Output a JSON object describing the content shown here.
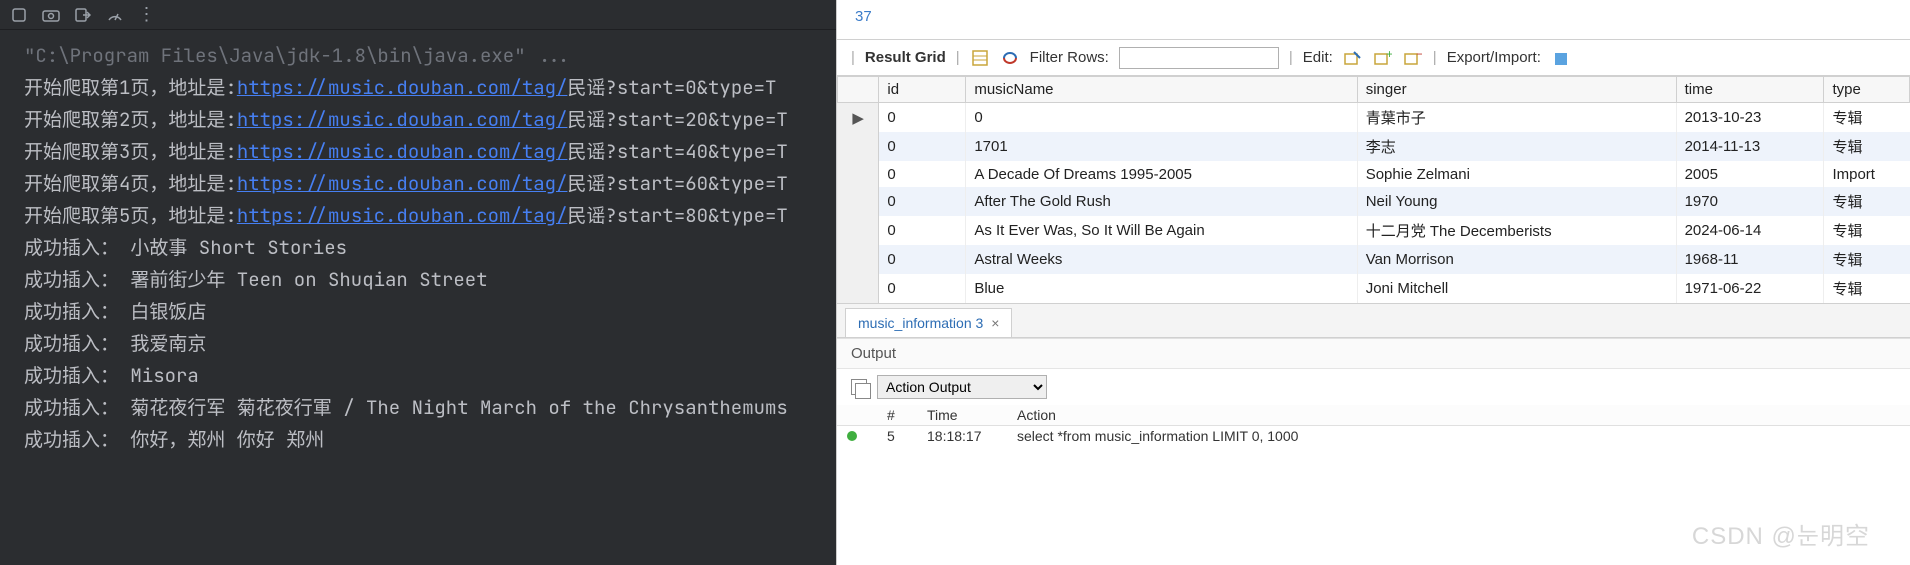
{
  "left": {
    "cmdline": "\"C:\\Program Files\\Java\\jdk-1.8\\bin\\java.exe\" ...",
    "crawl": [
      {
        "prefix": "开始爬取第1页，地址是:",
        "url": "https://music.douban.com/tag/",
        "suffix": "民谣?start=0&type=T"
      },
      {
        "prefix": "开始爬取第2页，地址是:",
        "url": "https://music.douban.com/tag/",
        "suffix": "民谣?start=20&type=T"
      },
      {
        "prefix": "开始爬取第3页，地址是:",
        "url": "https://music.douban.com/tag/",
        "suffix": "民谣?start=40&type=T"
      },
      {
        "prefix": "开始爬取第4页，地址是:",
        "url": "https://music.douban.com/tag/",
        "suffix": "民谣?start=60&type=T"
      },
      {
        "prefix": "开始爬取第5页，地址是:",
        "url": "https://music.douban.com/tag/",
        "suffix": "民谣?start=80&type=T"
      }
    ],
    "inserts": [
      "成功插入： 小故事 Short Stories",
      "成功插入： 署前街少年 Teen on Shuqian Street",
      "成功插入： 白银饭店",
      "成功插入： 我爱南京",
      "成功插入： Misora",
      "成功插入： 菊花夜行军  菊花夜行軍 / The Night March of the Chrysanthemums",
      "成功插入： 你好，郑州  你好 郑州"
    ]
  },
  "right": {
    "topNumber": "37",
    "toolbar": {
      "resultGrid": "Result Grid",
      "filterRows": "Filter Rows:",
      "edit": "Edit:",
      "exportImport": "Export/Import:",
      "filterValue": ""
    },
    "columns": {
      "id": "id",
      "musicName": "musicName",
      "singer": "singer",
      "time": "time",
      "type": "type"
    },
    "rows": [
      {
        "id": "0",
        "musicName": "0",
        "singer": "青葉市子",
        "time": "2013-10-23",
        "type": "专辑"
      },
      {
        "id": "0",
        "musicName": "1701",
        "singer": "李志",
        "time": "2014-11-13",
        "type": "专辑"
      },
      {
        "id": "0",
        "musicName": "A Decade Of Dreams 1995-2005",
        "singer": "Sophie Zelmani",
        "time": "2005",
        "type": "Import"
      },
      {
        "id": "0",
        "musicName": "After The Gold Rush",
        "singer": "Neil Young",
        "time": "1970",
        "type": "专辑"
      },
      {
        "id": "0",
        "musicName": "As It Ever Was, So It Will Be Again",
        "singer": "十二月党 The Decemberists",
        "time": "2024-06-14",
        "type": "专辑"
      },
      {
        "id": "0",
        "musicName": "Astral Weeks",
        "singer": "Van Morrison",
        "time": "1968-11",
        "type": "专辑"
      },
      {
        "id": "0",
        "musicName": "Blue",
        "singer": "Joni Mitchell",
        "time": "1971-06-22",
        "type": "专辑"
      }
    ],
    "tab": {
      "label": "music_information 3"
    },
    "output": {
      "title": "Output",
      "dropdown": "Action Output",
      "cols": {
        "num": "#",
        "time": "Time",
        "action": "Action"
      },
      "row": {
        "num": "5",
        "time": "18:18:17",
        "action": "select *from music_information LIMIT 0, 1000"
      }
    }
  },
  "watermark": "CSDN @눈明空"
}
